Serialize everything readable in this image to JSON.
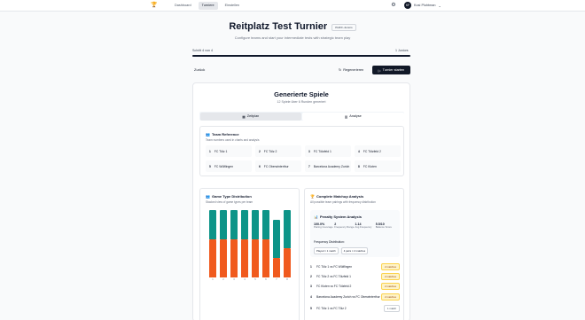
{
  "nav": {
    "logo_icon": "trophy-icon",
    "links": [
      {
        "label": "Dashboard",
        "active": false
      },
      {
        "label": "Turniere",
        "active": true
      },
      {
        "label": "Einstellen",
        "active": false
      }
    ],
    "settings_icon": "gear-icon",
    "user": {
      "initials": "KF",
      "name": "Kosi Pluhtman",
      "chevron": "⌄"
    }
  },
  "header": {
    "title": "Reitplatz Test Turnier",
    "badge": "PHIFF-Juniors",
    "subtitle": "Configure teams and start your intermediate tests with strategic team play"
  },
  "steps": {
    "left": "Schritt 4 von 4",
    "right": "1 Juniors",
    "progress": 1.0
  },
  "actions": {
    "back": "Zurück",
    "regenerate": "Regenerieren",
    "start": "Turnier starten"
  },
  "games": {
    "title": "Generierte Spiele",
    "subtitle": "12 Spiele über 6 Runden generiert",
    "tabs": [
      {
        "label": "Zeitplan",
        "icon": "calendar-icon",
        "selected": true
      },
      {
        "label": "Analyse",
        "icon": "bar-chart-icon",
        "selected": false
      }
    ]
  },
  "team_reference": {
    "title": "Team Reference",
    "subtitle": "Team numbers used in charts and analysis",
    "teams": [
      {
        "num": "1",
        "name": "FC Tölz 1"
      },
      {
        "num": "2",
        "name": "FC Tölz 2"
      },
      {
        "num": "3",
        "name": "FC Tölzfeld 1"
      },
      {
        "num": "4",
        "name": "FC Tölzfeld 2"
      },
      {
        "num": "5",
        "name": "FC Wülflingen"
      },
      {
        "num": "6",
        "name": "FC Oberwinterthur"
      },
      {
        "num": "7",
        "name": "Barcelona Academy Zurich"
      },
      {
        "num": "8",
        "name": "FC Kloten"
      }
    ]
  },
  "distribution": {
    "title": "Game Type Distribution",
    "subtitle": "Stacked view of game types per team",
    "colors": {
      "teal": "#0d9488",
      "orange": "#f05a1e"
    }
  },
  "chart_data": {
    "type": "bar",
    "categories": [
      "1",
      "2",
      "3",
      "4",
      "5",
      "6",
      "7",
      "8"
    ],
    "series": [
      {
        "values": [
          3,
          3,
          3,
          3,
          3,
          3,
          4,
          4
        ]
      },
      {
        "values": [
          4,
          4,
          4,
          4,
          4,
          4,
          2,
          3
        ]
      }
    ],
    "stacked": true,
    "ylim": [
      0,
      7
    ]
  },
  "matchup": {
    "title": "Complete Matchup Analysis",
    "subtitle": "All possible team pairings with frequency distribution",
    "penalty": {
      "title": "Penalty System Analysis",
      "stats": [
        {
          "value": "100.0%",
          "label": "Pairing Coverage"
        },
        {
          "value": "2",
          "label": "Frequency Range"
        },
        {
          "value": "1.14",
          "label": "Avg Frequency"
        },
        {
          "value": "5.5/10",
          "label": "Balance Score"
        }
      ],
      "freq_title": "Frequency Distribution:",
      "freq_tags": [
        "Played × 1 match",
        "4 pairs × 2 matches"
      ]
    },
    "rows": [
      {
        "num": "1",
        "text": "FC Tölz 1 vs FC Wülflingen",
        "pill": "2 matches",
        "two": true
      },
      {
        "num": "2",
        "text": "FC Tölz 2 vs FC Tölzfeld 1",
        "pill": "2 matches",
        "two": true
      },
      {
        "num": "3",
        "text": "FC Kloten vs FC Tölzfeld 2",
        "pill": "2 matches",
        "two": true
      },
      {
        "num": "4",
        "text": "Barcelona Academy Zurich vs FC Oberwinterthur",
        "pill": "2 matches",
        "two": true
      },
      {
        "num": "5",
        "text": "FC Tölz 1 vs FC Tölz 2",
        "pill": "1 match",
        "two": false
      }
    ]
  }
}
